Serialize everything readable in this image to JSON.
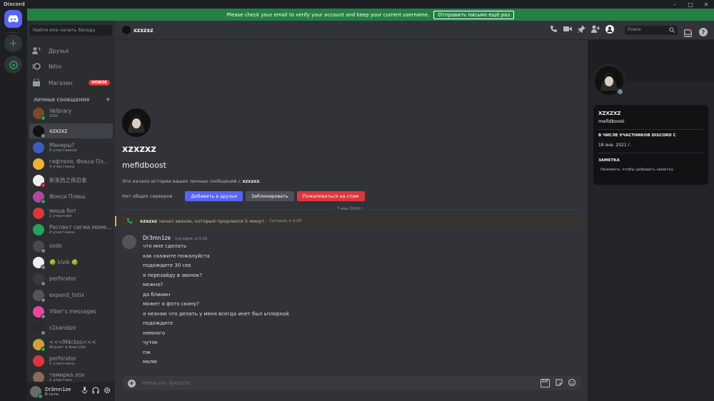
{
  "window": {
    "title": "Discord",
    "controls": [
      "–",
      "□",
      "✕"
    ]
  },
  "notice": {
    "text": "Please check your email to verify your account and keep your current username.",
    "button": "Отправить письмо ещё раз"
  },
  "sidebar": {
    "search_placeholder": "Найти или начать беседу",
    "nav": [
      {
        "label": "Друзья",
        "icon": "friends-icon"
      },
      {
        "label": "Nitro",
        "icon": "nitro-icon"
      },
      {
        "label": "Магазин",
        "icon": "shop-icon",
        "badge": "НОВОЕ"
      }
    ],
    "dm_header": "ЛИЧНЫЕ СООБЩЕНИЯ",
    "dm_add": "+",
    "dms": [
      {
        "name": "Velbrary",
        "sub": "SOO",
        "color": "#7a4a2a",
        "status": "#23a55a"
      },
      {
        "name": "xzxzxz",
        "sub": "",
        "color": "#111111",
        "status": "#80848e",
        "selected": true
      },
      {
        "name": "Манеры?",
        "sub": "6 участников",
        "color": "#3c5cbd",
        "status": ""
      },
      {
        "name": "гефтеля, Фокси Плюш, ...",
        "sub": "4 участника",
        "color": "#f0b232",
        "status": ""
      },
      {
        "name": "新潔西之夜忍者",
        "sub": "",
        "color": "#eeeeee",
        "status": "#da373c"
      },
      {
        "name": "Фокси Плюш",
        "sub": "",
        "color": "#b0489e",
        "status": "#23a55a"
      },
      {
        "name": "миша бот",
        "sub": "1 участник",
        "color": "#da373c",
        "status": ""
      },
      {
        "name": "Респект сигма момент",
        "sub": "4 участника",
        "color": "#23a55a",
        "status": ""
      },
      {
        "name": "sodo",
        "sub": "",
        "color": "#4a4a4a",
        "status": "#80848e"
      },
      {
        "name": "🥝 kivik 🥝",
        "sub": "",
        "color": "#eeeeee",
        "status": "#80848e"
      },
      {
        "name": "perforator",
        "sub": "",
        "color": "#3a3a3a",
        "status": "#80848e"
      },
      {
        "name": "expand_listix",
        "sub": "",
        "color": "#555555",
        "status": "#80848e"
      },
      {
        "name": "Viber's messages",
        "sub": "",
        "color": "#eb459e",
        "status": "#80848e"
      },
      {
        "name": "s1kanidzo",
        "sub": "",
        "color": "#2a2a2a",
        "status": "#80848e"
      },
      {
        "name": "<<<M4ckos<<<",
        "sub": "Играет в Real Life",
        "color": "#d4a03a",
        "status": "#23a55a"
      },
      {
        "name": "perforator",
        "sub": "2 участника",
        "color": "#da373c",
        "status": ""
      },
      {
        "name": "темирка лох",
        "sub": "1 участник",
        "color": "#8a6a5a",
        "status": ""
      }
    ],
    "user": {
      "name": "Dr3mn1ze",
      "status": "В сети"
    }
  },
  "chat": {
    "header_name": "xzxzxz",
    "search_placeholder": "Поиск",
    "intro": {
      "display_name": "xzxzxz",
      "username": "mefidboost",
      "text_prefix": "Это начало истории ваших личных сообщений с ",
      "text_name": "xzxzxz",
      "text_suffix": ".",
      "no_servers": "Нет общих серверов",
      "add_friend": "Добавить в друзья",
      "block": "Заблокировать",
      "report": "Пожаловаться на спам"
    },
    "date_divider": "7 мая 2024 г.",
    "call": {
      "name": "xzxzxz",
      "text": "начал звонок, который продлился 5 минут.",
      "time": "Сегодня, в 0:09"
    },
    "message": {
      "author": "Dr3mn1ze",
      "time": "Сегодня, в 0:10",
      "lines": [
        "что мне сделать",
        "как скажите пожалуйста",
        "подождите 30 сек",
        "я перезайду в звонок?",
        "можно?",
        "да блииин",
        "может я фото скину?",
        "я незнаю что делать у меня всегда инет был ьплорхой",
        "подождите",
        "немного",
        "чуток",
        "пж",
        "молю"
      ]
    },
    "composer_placeholder": "Написать @xzxzxz",
    "composer_gif": "GIF"
  },
  "profile": {
    "display_name": "XZXZXZ",
    "username": "mefidboost",
    "member_since_label": "В ЧИСЛЕ УЧАСТНИКОВ DISCORD С",
    "member_since": "18 янв. 2021 г.",
    "note_label": "ЗАМЕТКА",
    "note_placeholder": "Нажмите, чтобы добавить заметку"
  }
}
